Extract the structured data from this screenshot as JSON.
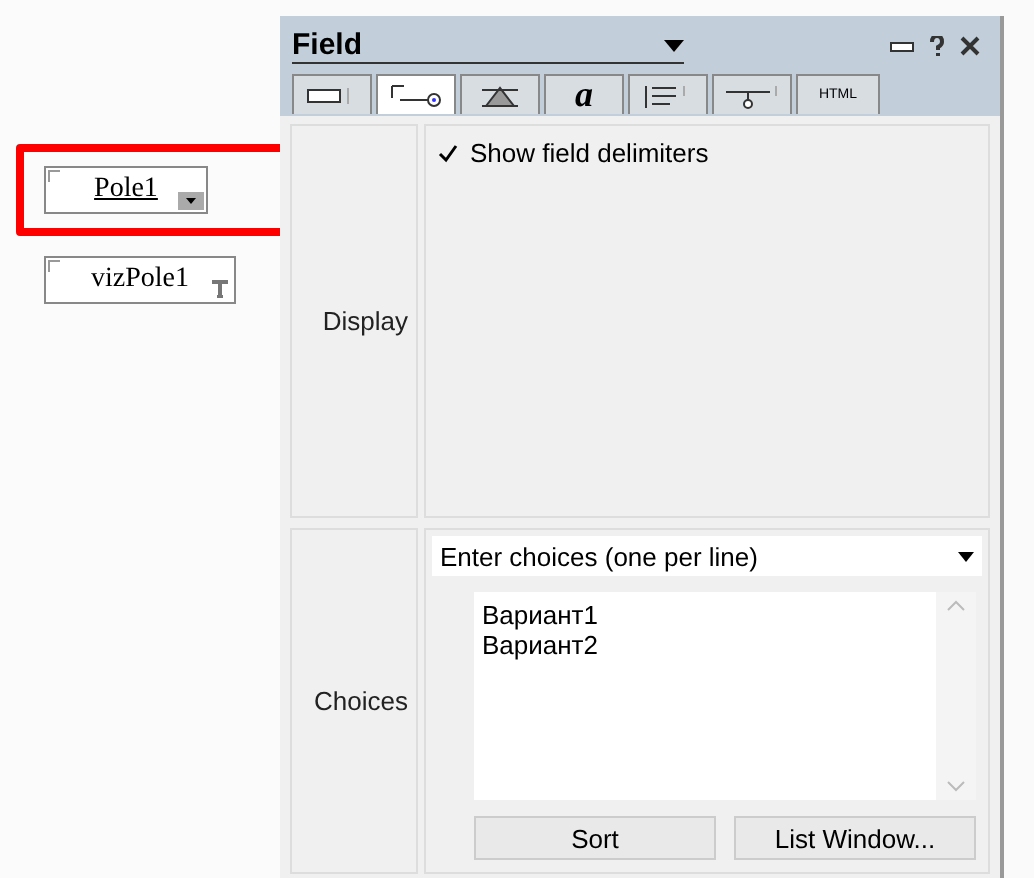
{
  "canvas": {
    "fields": [
      {
        "label": "Pole1",
        "kind": "dropdown",
        "selected": true
      },
      {
        "label": "vizPole1",
        "kind": "text",
        "selected": false
      }
    ]
  },
  "panel": {
    "title": "Field",
    "tabs": [
      {
        "kind": "box",
        "selected": false
      },
      {
        "kind": "field",
        "selected": true
      },
      {
        "kind": "colors",
        "selected": false
      },
      {
        "kind": "font",
        "label": "a",
        "selected": false
      },
      {
        "kind": "paragraph",
        "selected": false
      },
      {
        "kind": "borders",
        "selected": false
      },
      {
        "kind": "html",
        "label": "HTML",
        "selected": false
      }
    ],
    "display": {
      "label": "Display",
      "show_delimiters": {
        "label": "Show field delimiters",
        "checked": true
      }
    },
    "choices": {
      "label": "Choices",
      "mode": "Enter choices (one per line)",
      "items": [
        "Вариант1",
        "Вариант2"
      ],
      "buttons": [
        "Sort",
        "List Window..."
      ]
    }
  }
}
